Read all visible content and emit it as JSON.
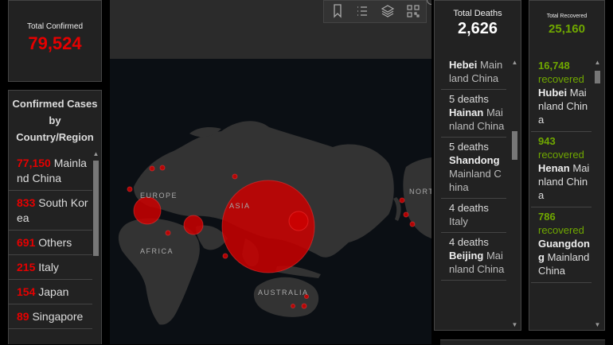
{
  "total_confirmed": {
    "title": "Total Confirmed",
    "value": "79,524"
  },
  "country_panel": {
    "title": "Confirmed Cases by Country/Region",
    "items": [
      {
        "count": "77,150",
        "name": "Mainland China"
      },
      {
        "count": "833",
        "name": "South Korea"
      },
      {
        "count": "691",
        "name": "Others"
      },
      {
        "count": "215",
        "name": "Italy"
      },
      {
        "count": "154",
        "name": "Japan"
      },
      {
        "count": "89",
        "name": "Singapore"
      }
    ]
  },
  "map": {
    "labels": {
      "europe": "EUROPE",
      "asia": "ASIA",
      "africa": "AFRICA",
      "australia": "AUSTRALIA",
      "north_america": "NORTH AMERICA"
    },
    "toolbar": [
      "bookmark-icon",
      "list-icon",
      "layers-icon",
      "qr-icon"
    ]
  },
  "deaths": {
    "title": "Total Deaths",
    "value": "2,626",
    "items": [
      {
        "count": "",
        "name": "Hebei",
        "region": "Mainland China"
      },
      {
        "count": "5 deaths",
        "name": "Hainan",
        "region": "Mainland China"
      },
      {
        "count": "5 deaths",
        "name": "Shandong",
        "region": "Mainland China"
      },
      {
        "count": "4 deaths",
        "name": "",
        "region": "Italy"
      },
      {
        "count": "4 deaths",
        "name": "Beijing",
        "region": "Mainland China"
      }
    ]
  },
  "recovered": {
    "title": "Total Recovered",
    "value": "25,160",
    "items": [
      {
        "count": "16,748",
        "label": "recovered",
        "name": "Hubei",
        "region": "Mainland China"
      },
      {
        "count": "943",
        "label": "recovered",
        "name": "Henan",
        "region": "Mainland China"
      },
      {
        "count": "786",
        "label": "recovered",
        "name": "Guangdong",
        "region": "Mainland China"
      }
    ]
  },
  "colors": {
    "confirmed": "#e60000",
    "recovered": "#70a800",
    "panel": "#222222",
    "map_water": "#0b0f14",
    "map_land": "#333333"
  }
}
